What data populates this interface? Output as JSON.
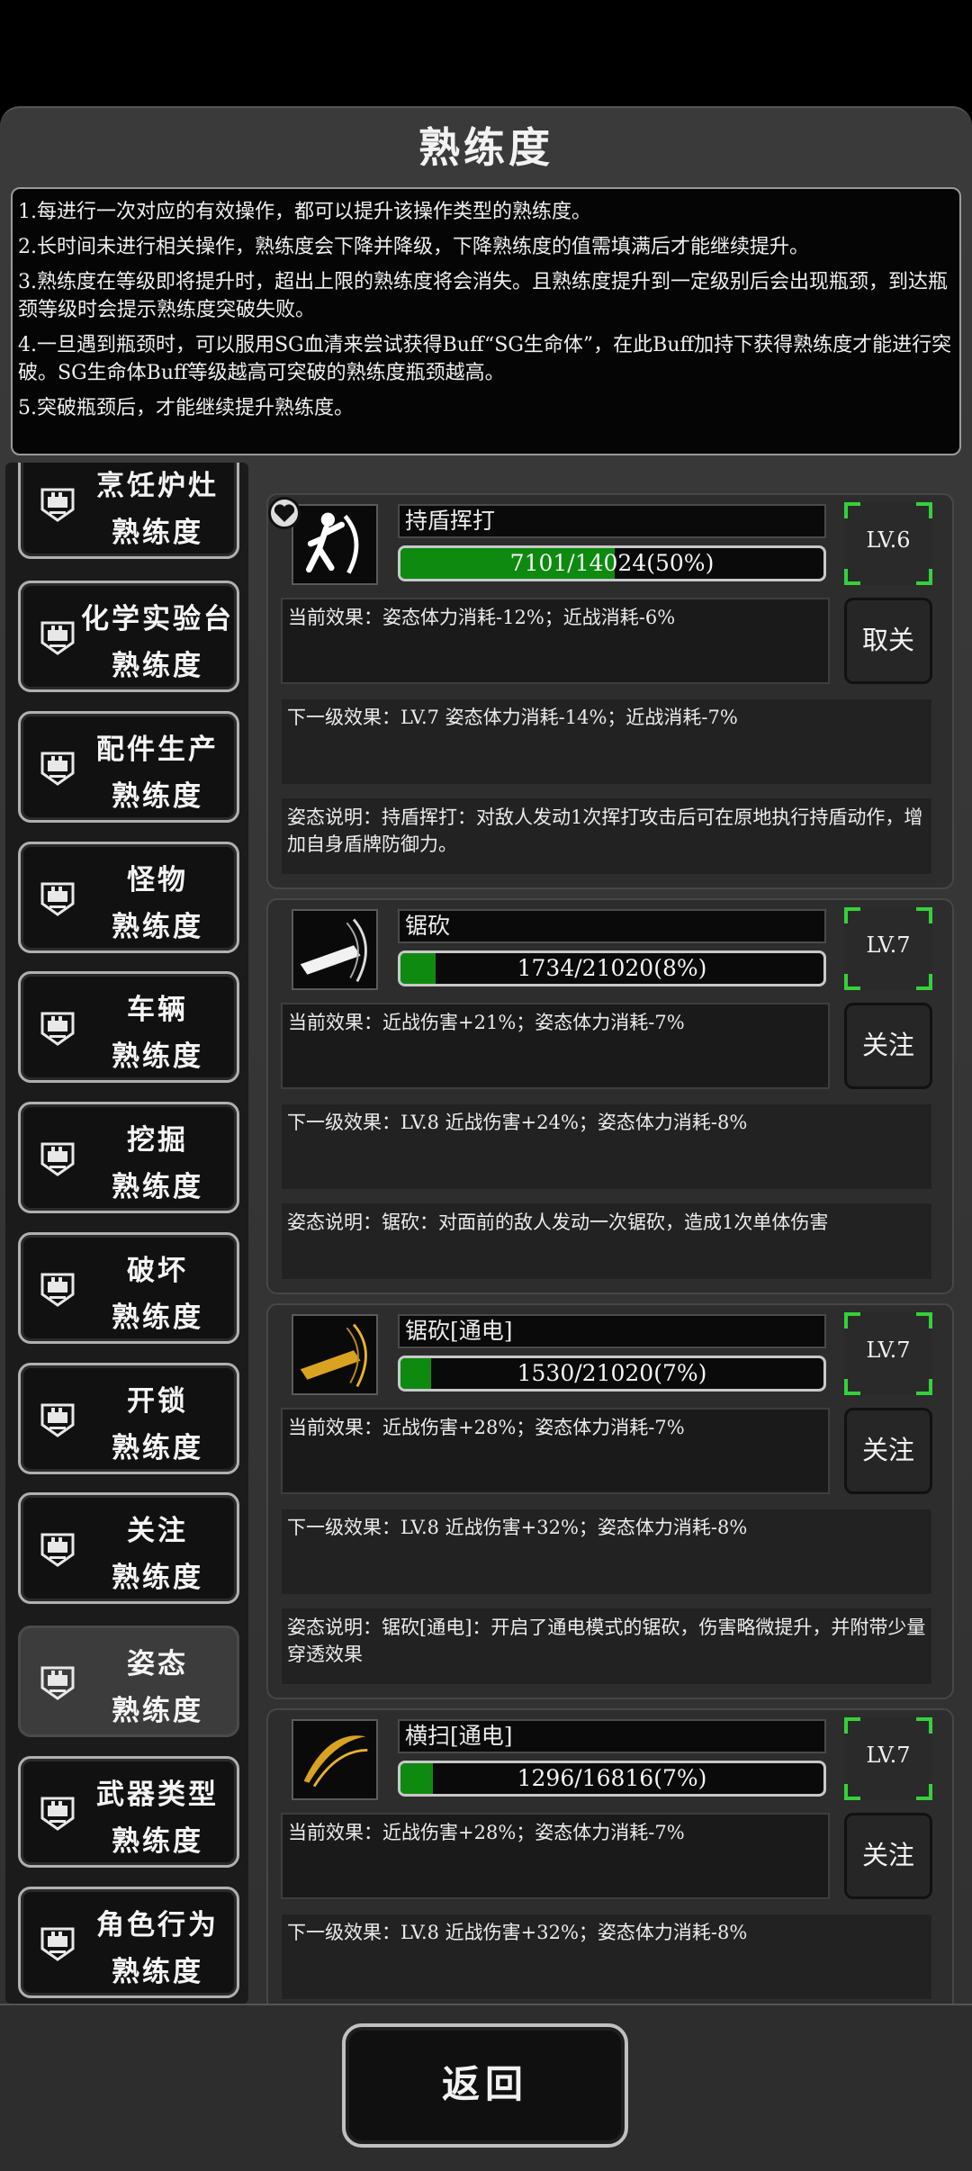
{
  "title": "熟练度",
  "rules": [
    "1.每进行一次对应的有效操作，都可以提升该操作类型的熟练度。",
    "2.长时间未进行相关操作，熟练度会下降并降级，下降熟练度的值需填满后才能继续提升。",
    "3.熟练度在等级即将提升时，超出上限的熟练度将会消失。且熟练度提升到一定级别后会出现瓶颈，到达瓶颈等级时会提示熟练度突破失败。",
    "4.一旦遇到瓶颈时，可以服用SG血清来尝试获得Buff“SG生命体”，在此Buff加持下获得熟练度才能进行突破。SG生命体Buff等级越高可突破的熟练度瓶颈越高。",
    "5.突破瓶颈后，才能继续提升熟练度。"
  ],
  "sidebar": [
    {
      "l1": "烹饪炉灶",
      "l2": "熟练度"
    },
    {
      "l1": "化学实验台",
      "l2": "熟练度"
    },
    {
      "l1": "配件生产",
      "l2": "熟练度"
    },
    {
      "l1": "怪物",
      "l2": "熟练度"
    },
    {
      "l1": "车辆",
      "l2": "熟练度"
    },
    {
      "l1": "挖掘",
      "l2": "熟练度"
    },
    {
      "l1": "破坏",
      "l2": "熟练度"
    },
    {
      "l1": "开锁",
      "l2": "熟练度"
    },
    {
      "l1": "关注",
      "l2": "熟练度"
    },
    {
      "l1": "姿态",
      "l2": "熟练度",
      "active": true
    },
    {
      "l1": "武器类型",
      "l2": "熟练度"
    },
    {
      "l1": "角色行为",
      "l2": "熟练度"
    }
  ],
  "cards": [
    {
      "name": "持盾挥打",
      "progress": "7101/14024(50%)",
      "fraction": 0.506,
      "level": "LV.6",
      "current": "当前效果：姿态体力消耗-12%；近战消耗-6%",
      "button": "取关",
      "next": "下一级效果：LV.7 姿态体力消耗-14%；近战消耗-7%",
      "desc": "姿态说明：持盾挥打：对敌人发动1次挥打攻击后可在原地执行持盾动作，增加自身盾牌防御力。",
      "icon": "shield-bash-icon"
    },
    {
      "name": "锯砍",
      "progress": "1734/21020(8%)",
      "fraction": 0.082,
      "level": "LV.7",
      "current": "当前效果：近战伤害+21%；姿态体力消耗-7%",
      "button": "关注",
      "next": "下一级效果：LV.8 近战伤害+24%；姿态体力消耗-8%",
      "desc": "姿态说明：锯砍：对面前的敌人发动一次锯砍，造成1次单体伤害",
      "icon": "chainsaw-icon"
    },
    {
      "name": "锯砍[通电]",
      "progress": "1530/21020(7%)",
      "fraction": 0.073,
      "level": "LV.7",
      "current": "当前效果：近战伤害+28%；姿态体力消耗-7%",
      "button": "关注",
      "next": "下一级效果：LV.8 近战伤害+32%；姿态体力消耗-8%",
      "desc": "姿态说明：锯砍[通电]：开启了通电模式的锯砍，伤害略微提升，并附带少量穿透效果",
      "icon": "electric-chainsaw-icon"
    },
    {
      "name": "横扫[通电]",
      "progress": "1296/16816(7%)",
      "fraction": 0.077,
      "level": "LV.7",
      "current": "当前效果：近战伤害+28%；姿态体力消耗-7%",
      "button": "关注",
      "next": "下一级效果：LV.8 近战伤害+32%；姿态体力消耗-8%",
      "desc": "",
      "icon": "sweep-slash-icon"
    }
  ],
  "back_label": "返回"
}
